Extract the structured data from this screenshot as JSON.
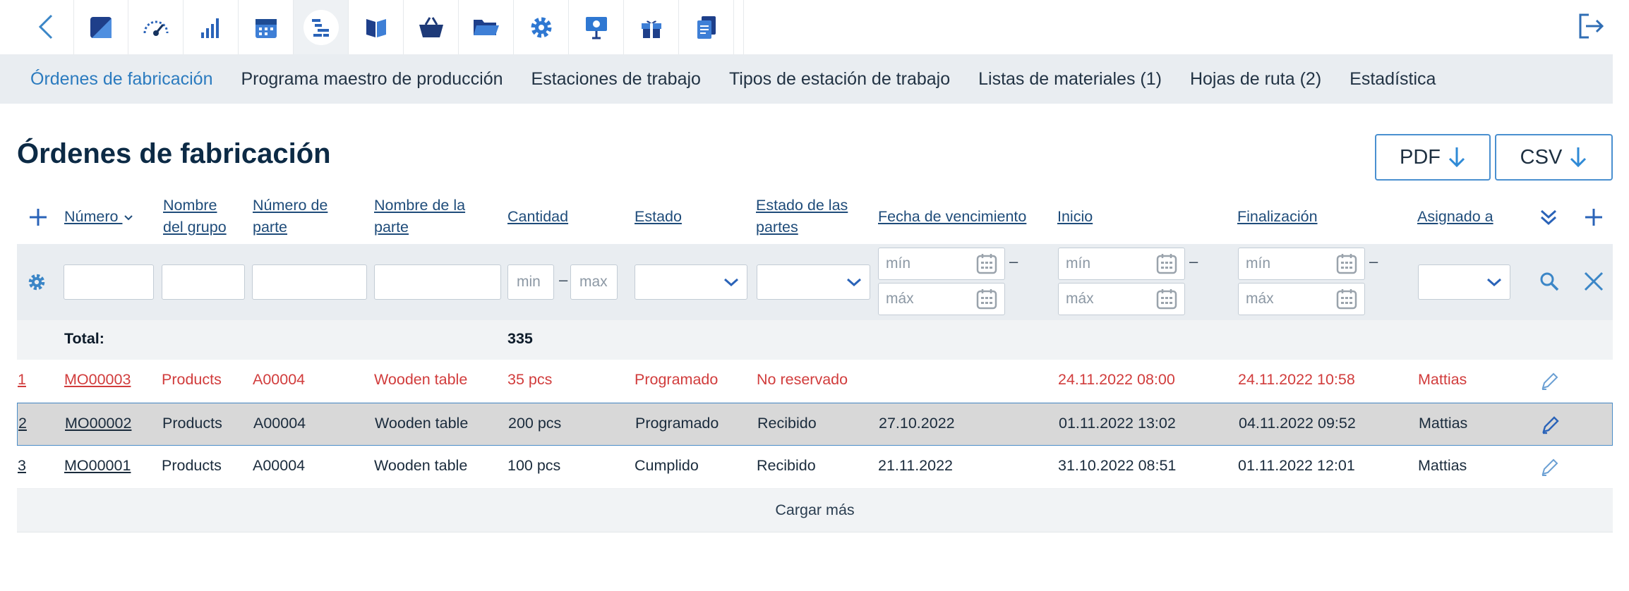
{
  "topbar": {
    "modules": [
      "dashboard-icon",
      "gauge-icon",
      "signal-bars-icon",
      "calendar-icon",
      "production-icon",
      "book-icon",
      "basket-icon",
      "folder-icon",
      "gear-icon",
      "presentation-icon",
      "gift-icon",
      "documents-icon"
    ]
  },
  "subnav": {
    "tabs": [
      "Órdenes de fabricación",
      "Programa maestro de producción",
      "Estaciones de trabajo",
      "Tipos de estación de trabajo",
      "Listas de materiales (1)",
      "Hojas de ruta (2)",
      "Estadística"
    ]
  },
  "page": {
    "title": "Órdenes de fabricación",
    "pdf_label": "PDF",
    "csv_label": "CSV"
  },
  "columns": {
    "numero": "Número",
    "grupo1": "Nombre",
    "grupo2": "del grupo",
    "parte1": "Número de",
    "parte2": "parte",
    "nombre1": "Nombre de la",
    "nombre2": "parte",
    "cantidad": "Cantidad",
    "estado": "Estado",
    "estpartes1": "Estado de las",
    "estpartes2": "partes",
    "vencimiento": "Fecha de vencimiento",
    "inicio": "Inicio",
    "finalizacion": "Finalización",
    "asignado": "Asignado a"
  },
  "filters": {
    "min": "min",
    "max": "max",
    "dmin": "mín",
    "dmax": "máx",
    "dash": "–"
  },
  "total": {
    "label": "Total:",
    "cantidad": "335"
  },
  "rows": [
    {
      "idx": "1",
      "numero": "MO00003",
      "grupo": "Products",
      "parte": "A00004",
      "nombre": "Wooden table",
      "cantidad": "35 pcs",
      "estado": "Programado",
      "est_partes": "No reservado",
      "vencimiento": "",
      "inicio": "24.11.2022 08:00",
      "fin": "24.11.2022 10:58",
      "asignado": "Mattias"
    },
    {
      "idx": "2",
      "numero": "MO00002",
      "grupo": "Products",
      "parte": "A00004",
      "nombre": "Wooden table",
      "cantidad": "200 pcs",
      "estado": "Programado",
      "est_partes": "Recibido",
      "vencimiento": "27.10.2022",
      "inicio": "01.11.2022 13:02",
      "fin": "04.11.2022 09:52",
      "asignado": "Mattias"
    },
    {
      "idx": "3",
      "numero": "MO00001",
      "grupo": "Products",
      "parte": "A00004",
      "nombre": "Wooden table",
      "cantidad": "100 pcs",
      "estado": "Cumplido",
      "est_partes": "Recibido",
      "vencimiento": "21.11.2022",
      "inicio": "31.10.2022 08:51",
      "fin": "01.11.2022 12:01",
      "asignado": "Mattias"
    }
  ],
  "load_more": "Cargar más",
  "colors": {
    "accent": "#2b7bbf",
    "overdue": "#d13c3c",
    "selected_row": "#d8d8d8"
  }
}
